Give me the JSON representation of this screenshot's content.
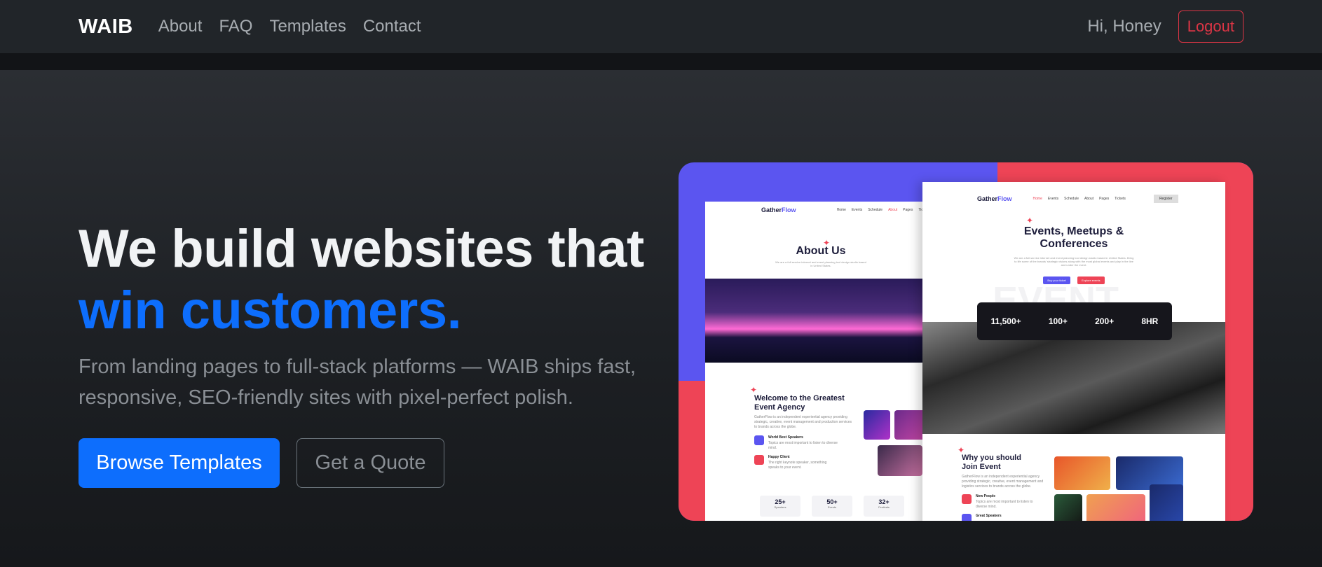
{
  "nav": {
    "brand": "WAIB",
    "links": [
      "About",
      "FAQ",
      "Templates",
      "Contact"
    ],
    "greeting": "Hi, Honey",
    "logout_label": "Logout"
  },
  "hero": {
    "headline_line1": "We build websites that",
    "headline_line2": "win customers.",
    "lead": "From landing pages to full-stack platforms — WAIB ships fast, responsive, SEO-friendly sites with pixel-perfect polish.",
    "primary_cta": "Browse Templates",
    "secondary_cta": "Get a Quote"
  },
  "preview": {
    "logo_prefix": "Gather",
    "logo_suffix": "Flow",
    "pageA": {
      "menu": [
        "Home",
        "Events",
        "Schedule",
        "About",
        "Pages",
        "Tickets"
      ],
      "title": "About Us",
      "subtitle": "We are a full service internet and event planning tool design studio based in United States.",
      "welcome_title": "Welcome to the Greatest Event Agency",
      "welcome_text": "GatherFlow is an independent experiential agency providing strategic, creative, event management and production services to brands across the globe.",
      "features": [
        {
          "title": "World Best Speakers",
          "text": "Topics are most important to listen to diverse mind."
        },
        {
          "title": "Happy Client",
          "text": "The right keynote speaker, something speaks to your event."
        }
      ],
      "stats": [
        {
          "value": "25+",
          "label": "Speakers"
        },
        {
          "value": "50+",
          "label": "Events"
        },
        {
          "value": "32+",
          "label": "Festivals"
        }
      ]
    },
    "pageB": {
      "menu": [
        "Home",
        "Events",
        "Schedule",
        "About",
        "Pages",
        "Tickets"
      ],
      "register": "Register",
      "title_line1": "Events, Meetups &",
      "title_line2": "Conferences",
      "subtitle": "We are a full service internet and event planning tool design studio based in United States. Bring to life some of the brands' strategic visions along with the most global events and play in the live and under the event.",
      "buy_ticket": "Buy your ticket",
      "explore": "Explore events",
      "watermark": "EVENT",
      "counters": [
        "11,500+",
        "100+",
        "200+",
        "8HR"
      ],
      "why_title": "Why you should Join Event",
      "why_text": "GatherFlow is an independent experiential agency providing strategic, creative, event management and logistics services to brands across the globe.",
      "features": [
        "New People",
        "Great Speakers"
      ],
      "feature_text": "Topics are most important to listen to diverse mind."
    }
  },
  "colors": {
    "primary": "#0d6efd",
    "danger": "#dc3545",
    "preview_purple": "#5b55f0",
    "preview_red": "#ee4456"
  }
}
